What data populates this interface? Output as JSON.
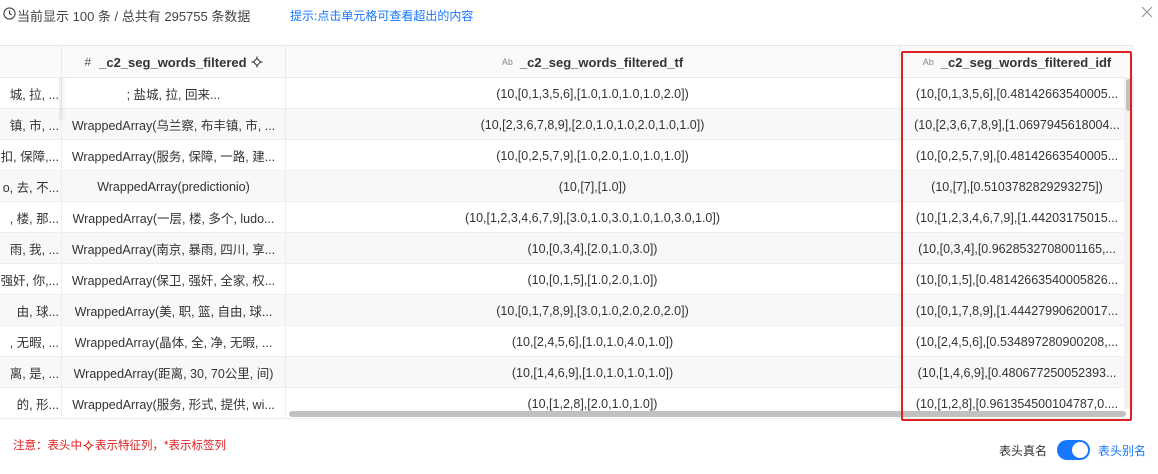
{
  "header_bar": {
    "info_text": "当前显示 100 条 / 总共有 295755 条数据",
    "hint_text": "提示:点击单元格可查看超出的内容",
    "icons": {
      "info": "clock-icon",
      "close": "close-icon"
    }
  },
  "table": {
    "columns": [
      {
        "label": "",
        "type_icon": ""
      },
      {
        "label": "_c2_seg_words_filtered",
        "type_icon": "#"
      },
      {
        "label": "_c2_seg_words_filtered_tf",
        "type_icon": "Ab"
      },
      {
        "label": "_c2_seg_words_filtered_idf",
        "type_icon": "Ab"
      }
    ],
    "rows": [
      [
        "城, 拉, ...",
        "; 盐城, 拉, 回来...",
        "(10,[0,1,3,5,6],[1.0,1.0,1.0,1.0,2.0])",
        "(10,[0,1,3,5,6],[0.48142663540005..."
      ],
      [
        "镇, 市, ...",
        "WrappedArray(乌兰察, 布丰镇, 市, ...",
        "(10,[2,3,6,7,8,9],[2.0,1.0,1.0,2.0,1.0,1.0])",
        "(10,[2,3,6,7,8,9],[1.0697945618004..."
      ],
      [
        "扣, 保障,...",
        "WrappedArray(服务, 保障, 一路, 建...",
        "(10,[0,2,5,7,9],[1.0,2.0,1.0,1.0,1.0])",
        "(10,[0,2,5,7,9],[0.48142663540005..."
      ],
      [
        "o, 去, 不...",
        "WrappedArray(predictionio)",
        "(10,[7],[1.0])",
        "(10,[7],[0.5103782829293275])"
      ],
      [
        ", 楼, 那...",
        "WrappedArray(一层, 楼, 多个, ludo...",
        "(10,[1,2,3,4,6,7,9],[3.0,1.0,3.0,1.0,1.0,3.0,1.0])",
        "(10,[1,2,3,4,6,7,9],[1.44203175015..."
      ],
      [
        "雨, 我, ...",
        "WrappedArray(南京, 暴雨, 四川, 享...",
        "(10,[0,3,4],[2.0,1.0,3.0])",
        "(10,[0,3,4],[0.9628532708001165,..."
      ],
      [
        "强奸, 你,...",
        "WrappedArray(保卫, 强奸, 全家, 权...",
        "(10,[0,1,5],[1.0,2.0,1.0])",
        "(10,[0,1,5],[0.48142663540005826..."
      ],
      [
        "由, 球...",
        "WrappedArray(美, 职, 篮, 自由, 球...",
        "(10,[0,1,7,8,9],[3.0,1.0,2.0,2.0,2.0])",
        "(10,[0,1,7,8,9],[1.44427990620017..."
      ],
      [
        ", 无暇, ...",
        "WrappedArray(晶体, 全, 净, 无暇, ...",
        "(10,[2,4,5,6],[1.0,1.0,4.0,1.0])",
        "(10,[2,4,5,6],[0.534897280900208,..."
      ],
      [
        "离, 是, ...",
        "WrappedArray(距离, 30, 70公里, 间)",
        "(10,[1,4,6,9],[1.0,1.0,1.0,1.0])",
        "(10,[1,4,6,9],[0.480677250052393..."
      ],
      [
        " 的, 形...",
        "WrappedArray(服务, 形式, 提供, wi...",
        "(10,[1,2,8],[2.0,1.0,1.0])",
        "(10,[1,2,8],[0.961354500104787,0...."
      ]
    ]
  },
  "footer": {
    "note_prefix": "注意：表头中",
    "note_suffix": "表示特征列，*表示标签列",
    "toggle_left_label": "表头真名",
    "toggle_right_label": "表头别名",
    "toggle_on": true,
    "accent_color": "#1677ff",
    "warn_color": "#e02020"
  }
}
